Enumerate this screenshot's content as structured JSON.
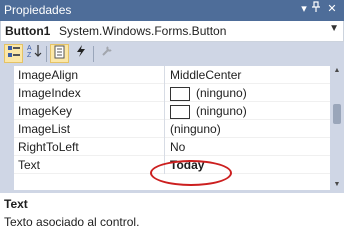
{
  "window": {
    "title": "Propiedades",
    "pin_icon": "pin-icon",
    "close_icon": "close-icon",
    "dropdown_icon": "chevron-down-icon"
  },
  "object": {
    "name": "Button1",
    "type": "System.Windows.Forms.Button"
  },
  "toolbar": {
    "buttons": [
      {
        "name": "categorized",
        "icon": "categorized-icon",
        "active": true
      },
      {
        "name": "alphabetical",
        "icon": "sort-az-icon",
        "active": false
      },
      {
        "name": "properties",
        "icon": "properties-icon",
        "active": true
      },
      {
        "name": "events",
        "icon": "lightning-icon",
        "active": false
      },
      {
        "name": "property-pages",
        "icon": "wrench-icon",
        "active": false
      }
    ]
  },
  "properties": [
    {
      "name": "ImageAlign",
      "value": "MiddleCenter"
    },
    {
      "name": "ImageIndex",
      "value": "(ninguno)",
      "swatch": true
    },
    {
      "name": "ImageKey",
      "value": "(ninguno)",
      "swatch": true
    },
    {
      "name": "ImageList",
      "value": "(ninguno)"
    },
    {
      "name": "RightToLeft",
      "value": "No"
    },
    {
      "name": "Text",
      "value": "Today",
      "bold": true
    }
  ],
  "description": {
    "title": "Text",
    "text": "Texto asociado al control."
  },
  "colors": {
    "titlebar": "#4e6d99",
    "toolbar": "#cfd6e5",
    "highlight_ellipse": "#cc1f1f",
    "active_button": "#fbe7a8"
  }
}
